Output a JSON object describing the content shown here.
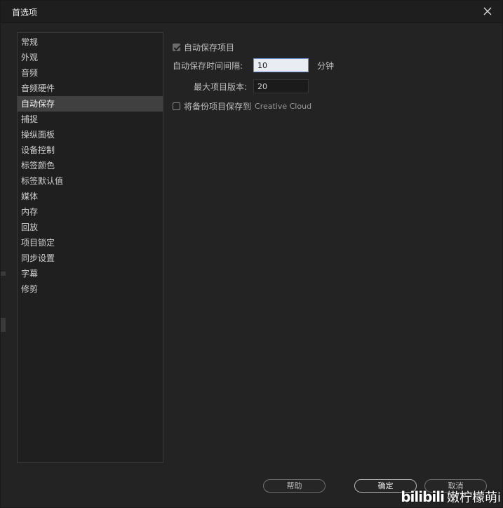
{
  "window": {
    "title": "首选项"
  },
  "sidebar": {
    "items": [
      {
        "label": "常规"
      },
      {
        "label": "外观"
      },
      {
        "label": "音频"
      },
      {
        "label": "音频硬件"
      },
      {
        "label": "自动保存",
        "selected": true
      },
      {
        "label": "捕捉"
      },
      {
        "label": "操纵面板"
      },
      {
        "label": "设备控制"
      },
      {
        "label": "标签颜色"
      },
      {
        "label": "标签默认值"
      },
      {
        "label": "媒体"
      },
      {
        "label": "内存"
      },
      {
        "label": "回放"
      },
      {
        "label": "项目锁定"
      },
      {
        "label": "同步设置"
      },
      {
        "label": "字幕"
      },
      {
        "label": "修剪"
      }
    ]
  },
  "autosave": {
    "auto_save_label": "自动保存项目",
    "auto_save_checked": true,
    "interval_label": "自动保存时间间隔:",
    "interval_value": "10",
    "interval_unit": "分钟",
    "max_versions_label": "最大项目版本:",
    "max_versions_value": "20",
    "cloud_backup_label": "将备份项目保存到",
    "cloud_backup_service": "Creative Cloud",
    "cloud_backup_checked": false
  },
  "buttons": {
    "help": "帮助",
    "ok": "确定",
    "cancel": "取消"
  },
  "watermark": {
    "logo": "bilibili",
    "text": "嫩柠檬萌i"
  },
  "colors": {
    "background": "#232323",
    "selected_item": "#404040",
    "focus_border": "#6b8fd6"
  }
}
